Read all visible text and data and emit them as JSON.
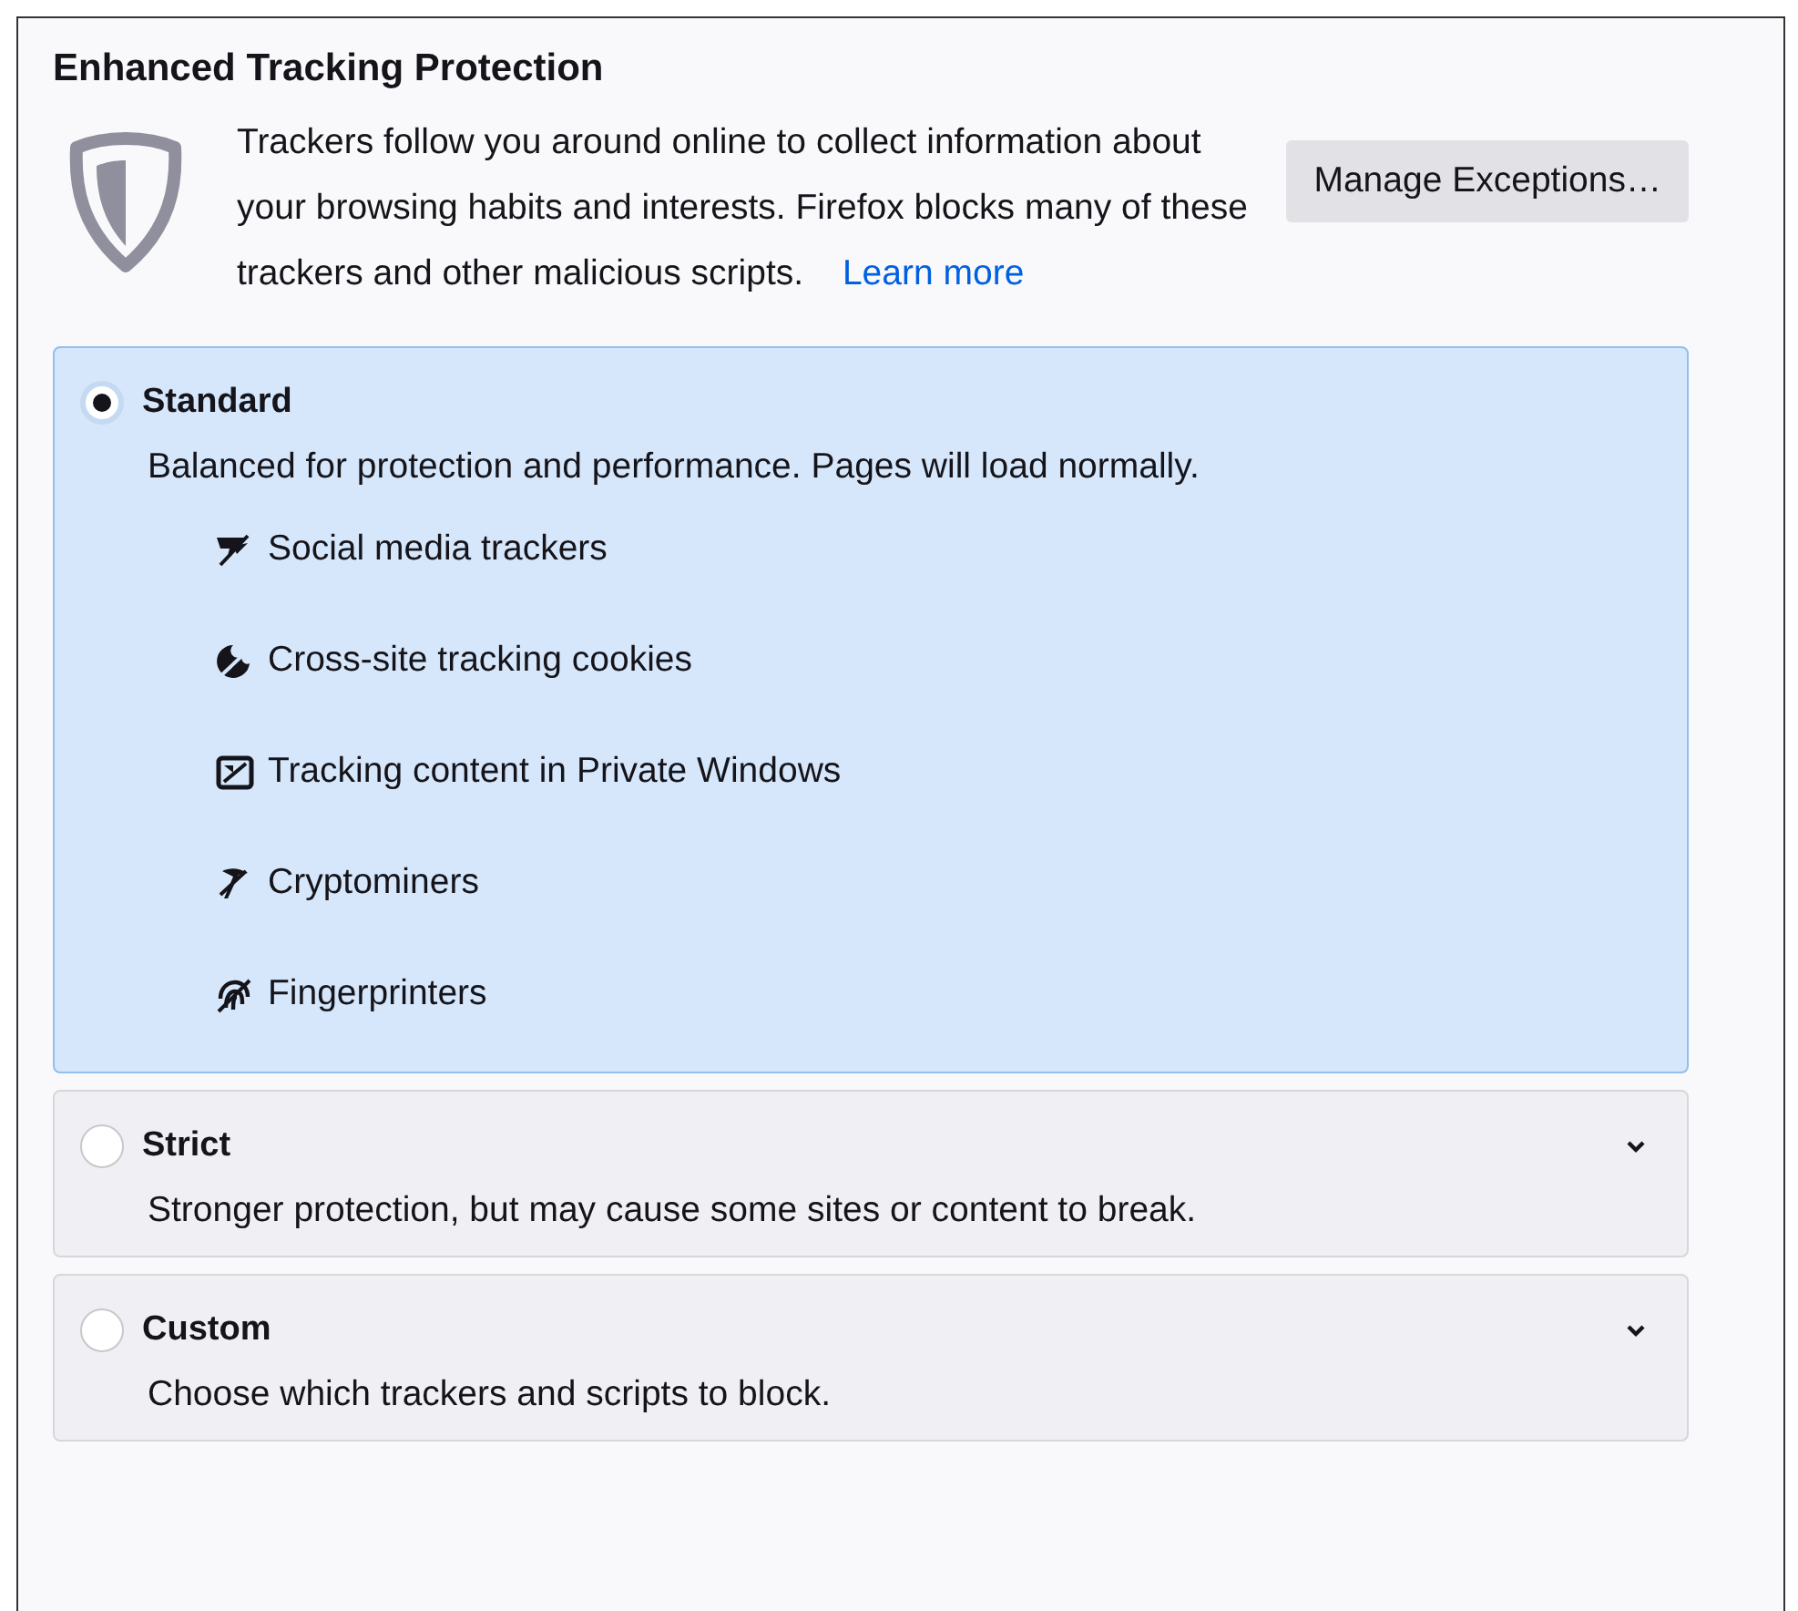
{
  "section": {
    "title": "Enhanced Tracking Protection",
    "description": "Trackers follow you around online to collect information about your browsing habits and interests. Firefox blocks many of these trackers and other malicious scripts.",
    "learn_more": "Learn more",
    "manage_button": {
      "label": "Manage Exceptions…"
    }
  },
  "options": [
    {
      "label": "Standard",
      "selected": true,
      "expanded": true,
      "description": "Balanced for protection and performance. Pages will load normally.",
      "items": [
        {
          "kind": "social",
          "label": "Social media trackers"
        },
        {
          "kind": "cookies",
          "label": "Cross-site tracking cookies"
        },
        {
          "kind": "content",
          "label": "Tracking content in Private Windows"
        },
        {
          "kind": "crypto",
          "label": "Cryptominers"
        },
        {
          "kind": "fingerprint",
          "label": "Fingerprinters"
        }
      ]
    },
    {
      "label": "Strict",
      "selected": false,
      "expanded": false,
      "description": "Stronger protection, but may cause some sites or content to break."
    },
    {
      "label": "Custom",
      "selected": false,
      "expanded": false,
      "description": "Choose which trackers and scripts to block."
    }
  ]
}
